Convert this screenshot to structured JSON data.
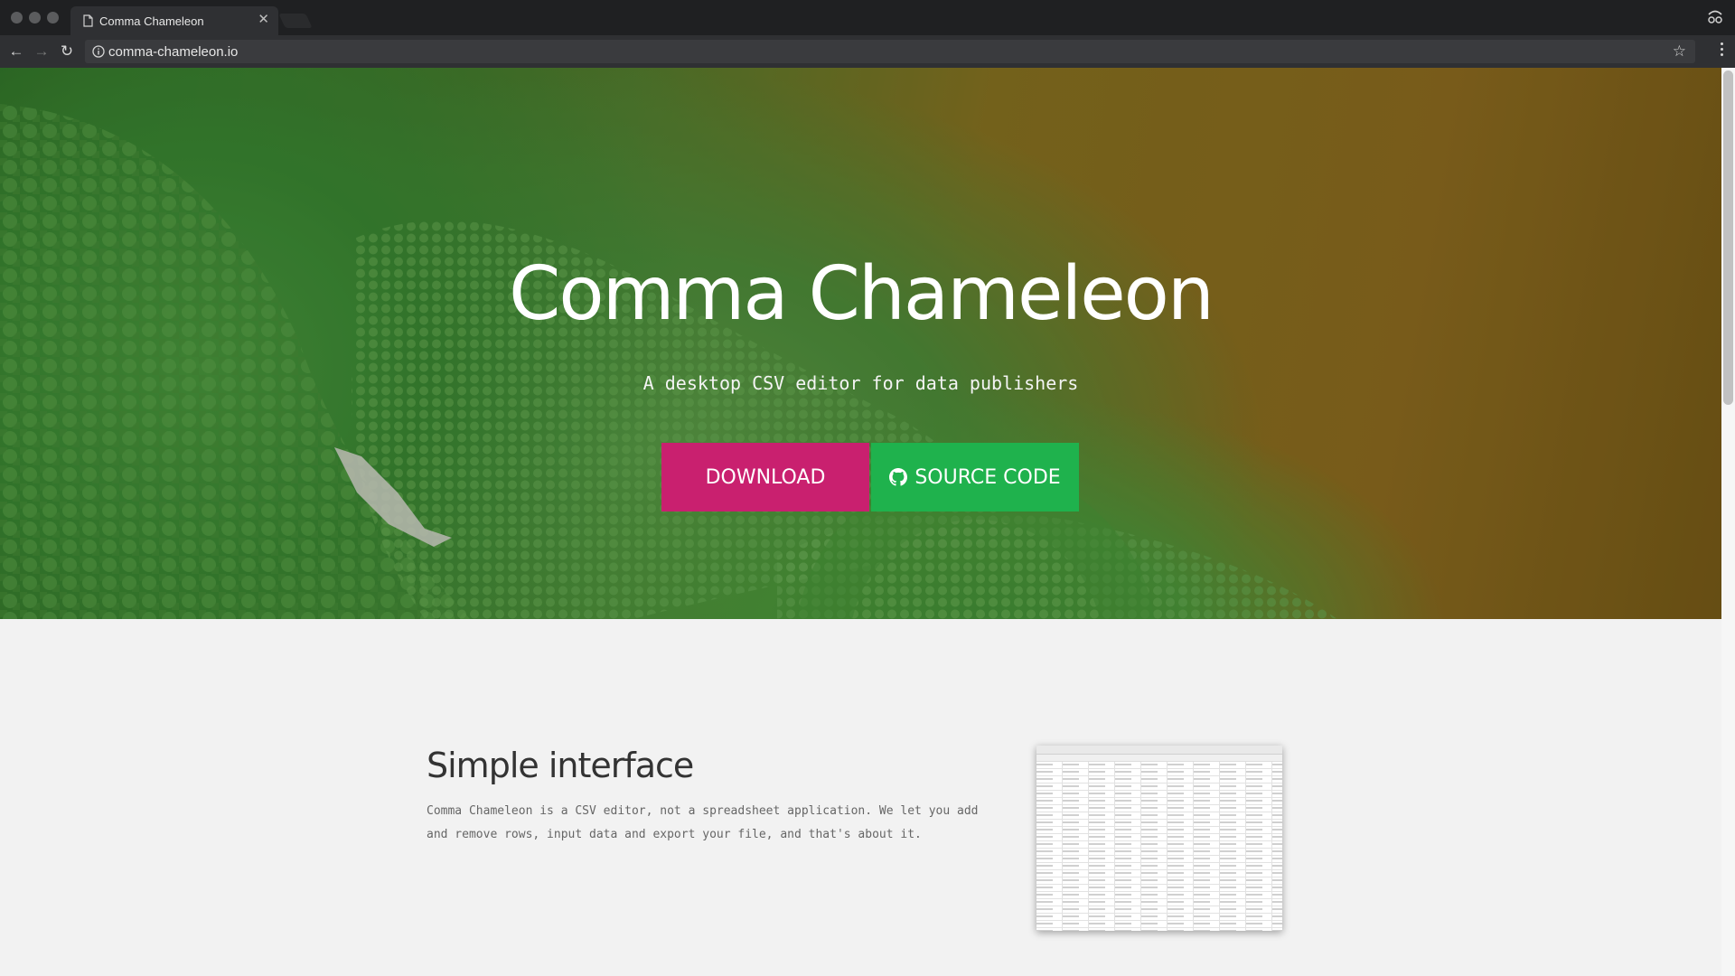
{
  "browser": {
    "tab_title": "Comma Chameleon",
    "url": "comma-chameleon.io"
  },
  "hero": {
    "title": "Comma Chameleon",
    "subtitle": "A desktop CSV editor for data publishers",
    "download_label": "DOWNLOAD",
    "source_label": "SOURCE CODE"
  },
  "feature": {
    "title": "Simple interface",
    "text": "Comma Chameleon is a CSV editor, not a spreadsheet application. We let you add and remove rows, input data and export your file, and that's about it."
  },
  "colors": {
    "download": "#c9206f",
    "source": "#1fb24d",
    "background": "#f2f2f2"
  },
  "icons": [
    "page-icon",
    "close-icon",
    "back-arrow-icon",
    "forward-arrow-icon",
    "reload-icon",
    "info-icon",
    "star-icon",
    "menu-icon",
    "github-icon",
    "profile-icon"
  ]
}
